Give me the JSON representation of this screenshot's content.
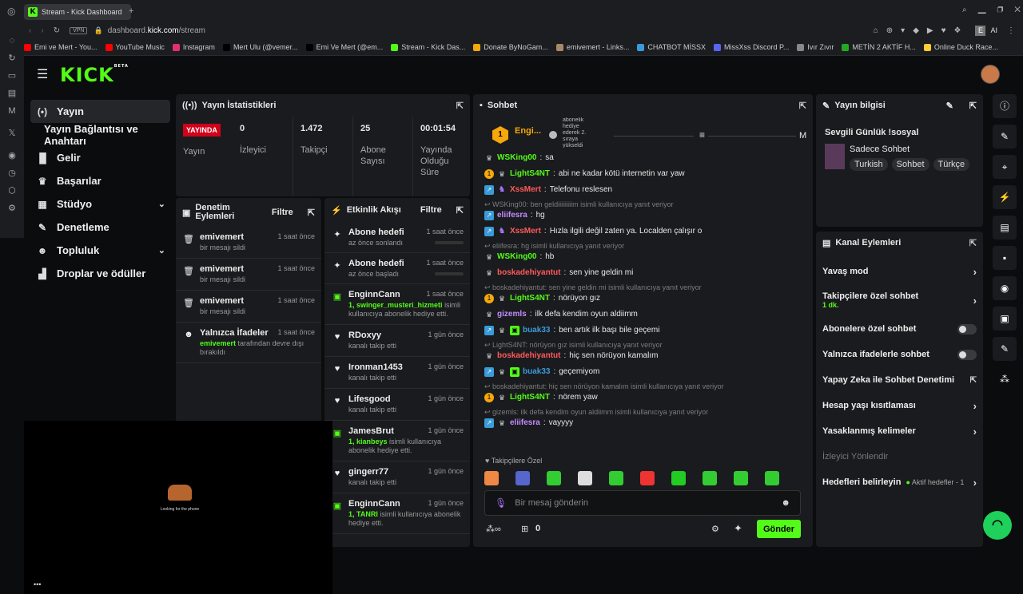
{
  "browser": {
    "tab_title": "Stream - Kick Dashboard",
    "url_plain": "dashboard.",
    "url_host": "kick.com",
    "url_path": "/stream",
    "vpn": "VPN",
    "ai": "AI",
    "profile": "E"
  },
  "bookmarks": [
    {
      "label": "Emi ve Mert - You...",
      "color": "#ff0000"
    },
    {
      "label": "YouTube Music",
      "color": "#ff0000"
    },
    {
      "label": "Instagram",
      "color": "#e1306c"
    },
    {
      "label": "Mert Ulu (@vemer...",
      "color": "#000000"
    },
    {
      "label": "Emi Ve Mert (@em...",
      "color": "#000000"
    },
    {
      "label": "Stream - Kick Das...",
      "color": "#53fc18"
    },
    {
      "label": "Donate ByNoGam...",
      "color": "#f5a70b"
    },
    {
      "label": "emivemert - Links...",
      "color": "#a86"
    },
    {
      "label": "CHATBOT MİSSX",
      "color": "#3a9bd9"
    },
    {
      "label": "MissXss Discord P...",
      "color": "#5865f2"
    },
    {
      "label": "Ivır Zıvır",
      "color": "#888888"
    },
    {
      "label": "METİN 2 AKTİF H...",
      "color": "#2a2"
    },
    {
      "label": "Online Duck Race...",
      "color": "#fc3"
    }
  ],
  "logo": {
    "text": "KICK",
    "beta": "BETA"
  },
  "nav": [
    {
      "icon": "(•)",
      "label": "Yayın"
    },
    {
      "icon": "",
      "label": "Yayın Bağlantısı ve Anahtarı"
    },
    {
      "icon": "▐▌",
      "label": "Gelir"
    },
    {
      "icon": "♛",
      "label": "Başarılar"
    },
    {
      "icon": "▦",
      "label": "Stüdyo"
    },
    {
      "icon": "✎",
      "label": "Denetleme"
    },
    {
      "icon": "☻",
      "label": "Topluluk"
    },
    {
      "icon": "▟",
      "label": "Droplar ve ödüller"
    }
  ],
  "stats": {
    "title": "Yayın İstatistikleri",
    "live": "YAYINDA",
    "items": [
      {
        "value": "0",
        "label": "İzleyici"
      },
      {
        "value": "1.472",
        "label": "Takipçi"
      },
      {
        "value": "25",
        "label": "Abone Sayısı"
      },
      {
        "value": "00:01:54",
        "label": "Yayında Olduğu Süre"
      }
    ],
    "live_label": "Yayın"
  },
  "mod": {
    "title": "Denetim Eylemleri",
    "filter": "Filtre",
    "rows": [
      {
        "name": "emivemert",
        "time": "1 saat önce",
        "text": "bir mesajı sildi"
      },
      {
        "name": "emivemert",
        "time": "1 saat önce",
        "text": "bir mesajı sildi"
      },
      {
        "name": "emivemert",
        "time": "1 saat önce",
        "text": "bir mesajı sildi"
      },
      {
        "name": "Yalnızca İfadeler",
        "time": "1 saat önce",
        "hl": "emivemert",
        "text": "tarafından devre dışı bırakıldı"
      }
    ]
  },
  "activity": {
    "title": "Etkinlik Akışı",
    "filter": "Filtre",
    "rows": [
      {
        "icon": "✦",
        "name": "Abone hedefi",
        "time": "1 saat önce",
        "text": "az önce sonlandı"
      },
      {
        "icon": "✦",
        "name": "Abone hedefi",
        "time": "1 saat önce",
        "text": "az önce başladı"
      },
      {
        "icon": "▣",
        "name": "EnginnCann",
        "time": "1 saat önce",
        "hl": "1, swinger_musteri_hizmeti",
        "text": "isimli kullanıcıya abonelik hediye etti."
      },
      {
        "icon": "♥",
        "name": "RDoxyy",
        "time": "1 gün önce",
        "text": "kanalı takip etti"
      },
      {
        "icon": "♥",
        "name": "Ironman1453",
        "time": "1 gün önce",
        "text": "kanalı takip etti"
      },
      {
        "icon": "♥",
        "name": "Lifesgood",
        "time": "1 gün önce",
        "text": "kanalı takip etti"
      },
      {
        "icon": "▣",
        "name": "JamesBrut",
        "time": "1 gün önce",
        "hl": "1, kianbeys",
        "text": "isimli kullanıcıya abonelik hediye etti."
      },
      {
        "icon": "♥",
        "name": "gingerr77",
        "time": "1 gün önce",
        "text": "kanalı takip etti"
      },
      {
        "icon": "▣",
        "name": "EnginnCann",
        "time": "1 gün önce",
        "hl": "1, TANRI",
        "text": "isimli kullanıcıya abonelik hediye etti."
      }
    ]
  },
  "chat": {
    "title": "Sohbet",
    "pinned_user": "Engi...",
    "pinned_count": "1",
    "gift_text": "abonelik hediye ederek 2. sıraya yükseldi",
    "m": "M",
    "messages": [
      {
        "user": "WSKing00",
        "color": "#53fc18",
        "text": "sa",
        "badges": [
          "crown"
        ]
      },
      {
        "user": "LightS4NT",
        "color": "#53fc18",
        "text": "abi ne kadar kötü internetin var yaw",
        "badges": [
          "gold",
          "crown"
        ]
      },
      {
        "user": "XssMert",
        "color": "#ff5b5b",
        "text": "Telefonu reslesen",
        "badges": [
          "blue",
          "sub"
        ]
      },
      {
        "reply": "WSKing00: ben geldiiiiiiiiim isimli kullanıcıya yanıt veriyor"
      },
      {
        "user": "eliifesra",
        "color": "#c58cff",
        "text": "hg",
        "badges": [
          "blue"
        ]
      },
      {
        "user": "XssMert",
        "color": "#ff5b5b",
        "text": "Hızla ilgili değil zaten ya. Localden çalışır o",
        "badges": [
          "blue",
          "sub"
        ]
      },
      {
        "reply": "eliifesra: hg isimli kullanıcıya yanıt veriyor"
      },
      {
        "user": "WSKing00",
        "color": "#53fc18",
        "text": "hb",
        "badges": [
          "crown"
        ]
      },
      {
        "user": "boskadehiyantut",
        "color": "#ff5b5b",
        "text": "sen yine geldin mi",
        "badges": [
          "crown"
        ]
      },
      {
        "reply": "boskadehiyantut: sen yine geldin mi isimli kullanıcıya yanıt veriyor"
      },
      {
        "user": "LightS4NT",
        "color": "#53fc18",
        "text": "nörüyon gız",
        "badges": [
          "gold",
          "crown"
        ]
      },
      {
        "user": "gizemls",
        "color": "#c58cff",
        "text": "ilk defa kendim oyun aldiimm",
        "badges": [
          "crown"
        ]
      },
      {
        "user": "buak33",
        "color": "#3a9bd9",
        "text": "ben artık ilk başı bile geçemi",
        "badges": [
          "blue",
          "crown",
          "green"
        ]
      },
      {
        "reply": "LightS4NT: nörüyon gız isimli kullanıcıya yanıt veriyor"
      },
      {
        "user": "boskadehiyantut",
        "color": "#ff5b5b",
        "text": "hiç sen nörüyon kamalım",
        "badges": [
          "crown"
        ]
      },
      {
        "user": "buak33",
        "color": "#3a9bd9",
        "text": "geçemiyom",
        "badges": [
          "blue",
          "crown",
          "green"
        ]
      },
      {
        "reply": "boskadehiyantut: hiç sen nörüyon kamalım isimli kullanıcıya yanıt veriyor"
      },
      {
        "user": "LightS4NT",
        "color": "#53fc18",
        "text": "nörem yaw",
        "badges": [
          "gold",
          "crown"
        ]
      },
      {
        "reply": "gizemls: ilk defa kendim oyun aldiimm isimli kullanıcıya yanıt veriyor"
      },
      {
        "user": "eliifesra",
        "color": "#c58cff",
        "text": "vayyyy",
        "badges": [
          "blue",
          "crown"
        ]
      }
    ],
    "followers_only": "Takipçilere Özel",
    "placeholder": "Bir mesaj gönderin",
    "count": "0",
    "send": "Gönder"
  },
  "info": {
    "title": "Yayın bilgisi",
    "stream_title": "Sevgili Günlük !sosyal",
    "category": "Sadece Sohbet",
    "tags": [
      "Turkish",
      "Sohbet",
      "Türkçe"
    ]
  },
  "channel": {
    "title": "Kanal Eylemleri",
    "items": [
      {
        "label": "Yavaş mod",
        "type": "chev"
      },
      {
        "label": "Takipçilere özel sohbet",
        "sub": "1 dk.",
        "type": "chev"
      },
      {
        "label": "Abonelere özel sohbet",
        "type": "toggle"
      },
      {
        "label": "Yalnızca ifadelerle sohbet",
        "type": "toggle"
      },
      {
        "label": "Yapay Zeka ile Sohbet Denetimi",
        "type": "ext"
      },
      {
        "label": "Hesap yaşı kısıtlaması",
        "type": "chev"
      },
      {
        "label": "Yasaklanmış kelimeler",
        "type": "chev"
      },
      {
        "label": "İzleyici Yönlendir",
        "type": "dim"
      },
      {
        "label": "Hedefleri belirleyin",
        "sub": "Aktif hedefler - 1",
        "type": "goal"
      }
    ]
  },
  "video": {
    "caption": "Looking for the phone"
  }
}
